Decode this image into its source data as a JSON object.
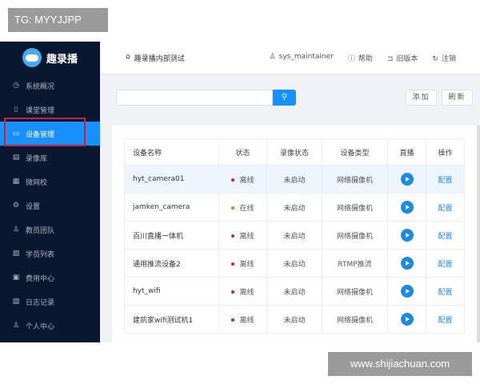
{
  "overlay_label": "TG: MYYJJPP",
  "watermark": "www.shijiachuan.com",
  "app": {
    "name": "趣录播"
  },
  "sidebar": {
    "items": [
      {
        "label": "系统概况",
        "icon": "dashboard-icon",
        "glyph": "◷"
      },
      {
        "label": "课堂管理",
        "icon": "book-icon",
        "glyph": "▯"
      },
      {
        "label": "设备管理",
        "icon": "camera-icon",
        "glyph": "▭",
        "active": true
      },
      {
        "label": "录像库",
        "icon": "video-library-icon",
        "glyph": "▤"
      },
      {
        "label": "微网校",
        "icon": "school-icon",
        "glyph": "▦"
      },
      {
        "label": "设置",
        "icon": "gear-icon",
        "glyph": "⚙"
      },
      {
        "label": "教员团队",
        "icon": "team-icon",
        "glyph": "♙"
      },
      {
        "label": "学员列表",
        "icon": "list-icon",
        "glyph": "▧"
      },
      {
        "label": "费用中心",
        "icon": "billing-icon",
        "glyph": "▣"
      },
      {
        "label": "日志记录",
        "icon": "log-icon",
        "glyph": "▧"
      },
      {
        "label": "个人中心",
        "icon": "user-icon",
        "glyph": "♙"
      }
    ]
  },
  "header": {
    "breadcrumb": "趣录播内部测试",
    "user": "sys_maintainer",
    "help": "帮助",
    "old_version": "旧版本",
    "logout": "注销"
  },
  "toolbar": {
    "search_placeholder": "",
    "add": "添加",
    "refresh": "刷新"
  },
  "table": {
    "columns": [
      "设备名称",
      "状态",
      "录像状态",
      "设备类型",
      "直播",
      "操作"
    ],
    "rows": [
      {
        "name": "hyt_camera01",
        "status": "离线",
        "status_color": "#c8203a",
        "record": "未启动",
        "type": "网络摄像机",
        "action": "配置"
      },
      {
        "name": "jamken_camera",
        "status": "在线",
        "status_color": "#52c41a",
        "record": "未启动",
        "type": "网络摄像机",
        "action": "配置"
      },
      {
        "name": "百川直播一体机",
        "status": "离线",
        "status_color": "#c8203a",
        "record": "未启动",
        "type": "网络摄像机",
        "action": "配置"
      },
      {
        "name": "通用推流设备2",
        "status": "离线",
        "status_color": "#c8203a",
        "record": "未启动",
        "type": "RTMP推流",
        "action": "配置"
      },
      {
        "name": "hyt_wifi",
        "status": "离线",
        "status_color": "#c8203a",
        "record": "未启动",
        "type": "网络摄像机",
        "action": "配置"
      },
      {
        "name": "建凯家wifi测试机1",
        "status": "离线",
        "status_color": "#c8203a",
        "record": "未启动",
        "type": "网络摄像机",
        "action": "配置"
      }
    ]
  },
  "colors": {
    "accent": "#1890ff",
    "sidebar": "#0a1730",
    "highlight_box": "#c8203a"
  }
}
